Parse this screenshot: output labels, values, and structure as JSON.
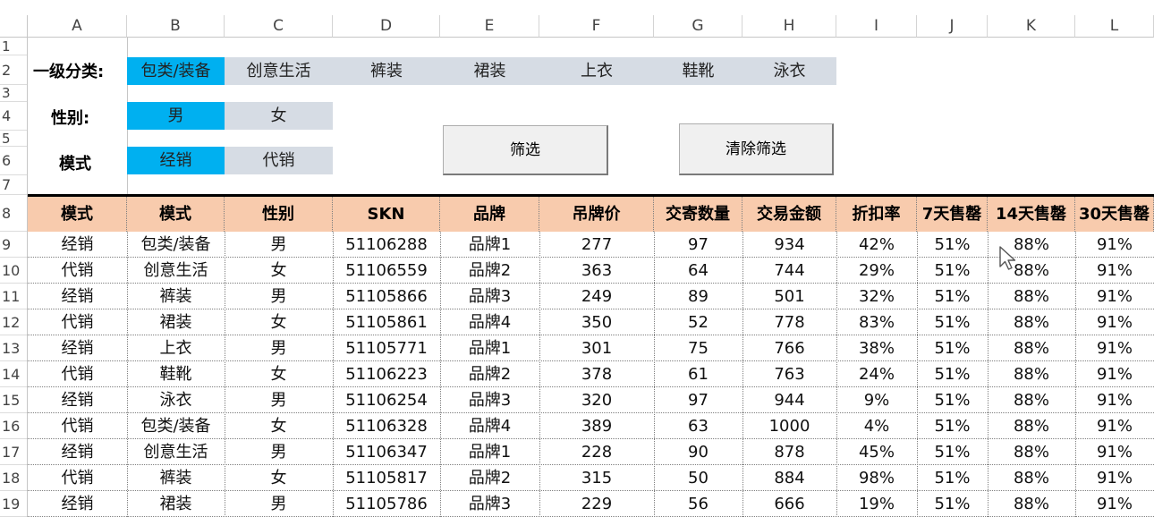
{
  "columns": [
    "A",
    "B",
    "C",
    "D",
    "E",
    "F",
    "G",
    "H",
    "I",
    "J",
    "K",
    "L"
  ],
  "rows": [
    "1",
    "2",
    "3",
    "4",
    "5",
    "6",
    "7",
    "8",
    "9",
    "10",
    "11",
    "12",
    "13",
    "14",
    "15",
    "16",
    "17",
    "18",
    "19"
  ],
  "filters": {
    "category_label": "一级分类:",
    "category_options": [
      {
        "label": "包类/装备",
        "selected": true
      },
      {
        "label": "创意生活",
        "selected": false
      },
      {
        "label": "裤装",
        "selected": false
      },
      {
        "label": "裙装",
        "selected": false
      },
      {
        "label": "上衣",
        "selected": false
      },
      {
        "label": "鞋靴",
        "selected": false
      },
      {
        "label": "泳衣",
        "selected": false
      }
    ],
    "gender_label": "性别:",
    "gender_options": [
      {
        "label": "男",
        "selected": true
      },
      {
        "label": "女",
        "selected": false
      }
    ],
    "mode_label": "模式",
    "mode_options": [
      {
        "label": "经销",
        "selected": true
      },
      {
        "label": "代销",
        "selected": false
      }
    ]
  },
  "buttons": {
    "filter": "筛选",
    "clear": "清除筛选"
  },
  "table": {
    "headers": [
      "模式",
      "模式",
      "性别",
      "SKN",
      "品牌",
      "吊牌价",
      "交寄数量",
      "交易金额",
      "折扣率",
      "7天售罄",
      "14天售罄",
      "30天售罄"
    ],
    "rows": [
      [
        "经销",
        "包类/装备",
        "男",
        "51106288",
        "品牌1",
        "277",
        "97",
        "934",
        "42%",
        "51%",
        "88%",
        "91%"
      ],
      [
        "代销",
        "创意生活",
        "女",
        "51106559",
        "品牌2",
        "363",
        "64",
        "744",
        "29%",
        "51%",
        "88%",
        "91%"
      ],
      [
        "经销",
        "裤装",
        "男",
        "51105866",
        "品牌3",
        "249",
        "89",
        "501",
        "32%",
        "51%",
        "88%",
        "91%"
      ],
      [
        "代销",
        "裙装",
        "女",
        "51105861",
        "品牌4",
        "350",
        "52",
        "778",
        "83%",
        "51%",
        "88%",
        "91%"
      ],
      [
        "经销",
        "上衣",
        "男",
        "51105771",
        "品牌1",
        "301",
        "75",
        "766",
        "38%",
        "51%",
        "88%",
        "91%"
      ],
      [
        "代销",
        "鞋靴",
        "女",
        "51106223",
        "品牌2",
        "378",
        "61",
        "763",
        "24%",
        "51%",
        "88%",
        "91%"
      ],
      [
        "经销",
        "泳衣",
        "男",
        "51106254",
        "品牌3",
        "320",
        "97",
        "944",
        "9%",
        "51%",
        "88%",
        "91%"
      ],
      [
        "代销",
        "包类/装备",
        "女",
        "51106328",
        "品牌4",
        "389",
        "63",
        "1000",
        "4%",
        "51%",
        "88%",
        "91%"
      ],
      [
        "经销",
        "创意生活",
        "男",
        "51106347",
        "品牌1",
        "228",
        "90",
        "878",
        "45%",
        "51%",
        "88%",
        "91%"
      ],
      [
        "代销",
        "裤装",
        "女",
        "51105817",
        "品牌2",
        "315",
        "50",
        "884",
        "98%",
        "51%",
        "88%",
        "91%"
      ],
      [
        "经销",
        "裙装",
        "男",
        "51105786",
        "品牌3",
        "229",
        "56",
        "666",
        "19%",
        "51%",
        "88%",
        "91%"
      ]
    ]
  },
  "colors": {
    "selected": "#00b0f0",
    "unselected": "#d6dce4",
    "header_fill": "#f8cbad"
  }
}
